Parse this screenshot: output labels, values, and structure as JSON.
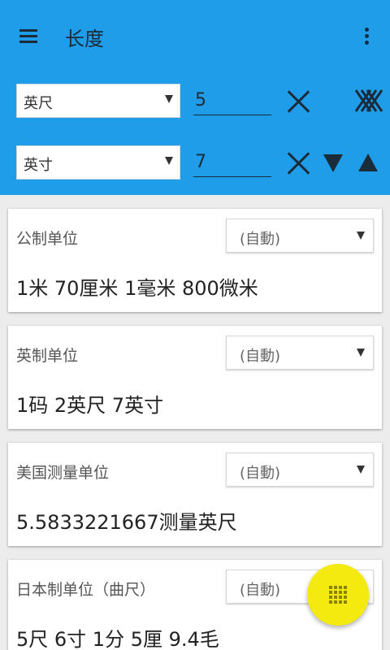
{
  "app_bar": {
    "title": "长度",
    "menu_icon": "hamburger-menu-icon",
    "more_icon": "more-vert-icon",
    "background_color": "#1f9de9"
  },
  "converter": {
    "from": {
      "unit": "英尺",
      "value": "5"
    },
    "to": {
      "unit": "英寸",
      "value": "7"
    },
    "clear_icon": "close-x-icon",
    "clear_all_icon": "clear-all-icon",
    "move_down_icon": "arrow-down-triangle-icon",
    "move_up_icon": "arrow-up-triangle-icon"
  },
  "cards": [
    {
      "title": "公制单位",
      "mode": "(自動)",
      "value": "1米 70厘米 1毫米 800微米"
    },
    {
      "title": "英制单位",
      "mode": "(自動)",
      "value": "1码 2英尺 7英寸"
    },
    {
      "title": "美国测量单位",
      "mode": "(自動)",
      "value": "5.5833221667测量英尺"
    },
    {
      "title": "日本制单位（曲尺）",
      "mode": "(自動)",
      "value": "5尺 6寸 1分 5厘 9.4毛"
    }
  ],
  "fab": {
    "icon": "keypad-grid-icon",
    "color": "#f5ea0f"
  }
}
